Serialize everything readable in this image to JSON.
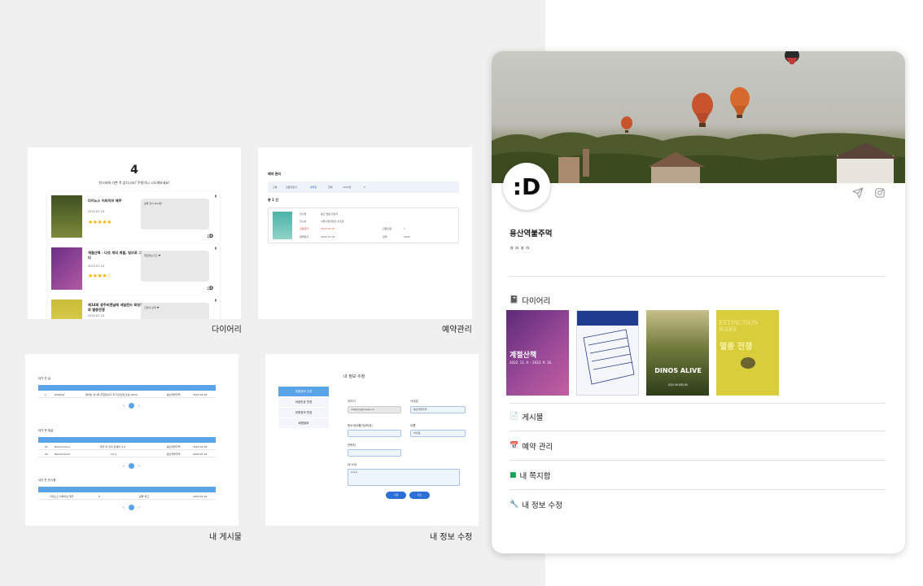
{
  "captions": {
    "diary": "다이어리",
    "reservation": "예약관리",
    "board": "내 게시물",
    "edit": "내 정보 수정"
  },
  "diary_panel": {
    "count": "4",
    "subtitle": "한시되에 기쁜 적 없디고요? 주말이니 시도해보세요!",
    "entries": [
      {
        "title": "다이노스 어라이브 제주",
        "date": "2023-07-24",
        "stars": "★★★★★",
        "memo": "공룡 정시 Nez닭!",
        "logo": ":D"
      },
      {
        "title": "계절산책 - 다섯 개의 계절, 빛으로 그리다",
        "date": "2023-07-24",
        "stars": "★★★★☆",
        "memo": "재밌었는다고 ♥",
        "logo": ":D"
      },
      {
        "title": "제14회 광주비엔날레 세일런드 회빙으로 멸종전쟁",
        "date": "2023-07-24",
        "stars": "",
        "memo": "긴장이 브레 ♥",
        "logo": ""
      }
    ]
  },
  "reservation_panel": {
    "title": "예약 관리",
    "filter_label": "구분",
    "filter_options": [
      "관람전일자",
      "예약일",
      "전체"
    ],
    "filter_value": "2023년",
    "count": "총 1 건",
    "rows": [
      [
        "전시명",
        "용산 법원 앙상리"
      ],
      [
        "전시처",
        "서울시립미술관 서소문"
      ],
      [
        "관람일자",
        "2023-07-27"
      ],
      [
        "결제일자",
        "2023-07-24"
      ]
    ],
    "side_rows": [
      [
        "관람인원",
        "1"
      ],
      [
        "금액",
        "4000"
      ]
    ]
  },
  "board_panel": {
    "sections": [
      {
        "label": "내가 쓴 글",
        "rows": [
          [
            "1",
            "6005ide",
            "에너빈 전시회 추천합니다 후 다인인제 관보 (Post)",
            "용산역불주먹",
            "2023-07-24"
          ]
        ]
      },
      {
        "label": "내가 쓴 댓글",
        "rows": [
          [
            "41",
            "Recommend",
            "법주 미 장미 관새이 ㅎㅎ",
            "용산역불주먹",
            "2023-07-24"
          ],
          [
            "42",
            "Recommend",
            "ㅋㅋㅋ",
            "용산역불주먹",
            "2023-07-24"
          ]
        ]
      },
      {
        "label": "내가 쓴 전시평",
        "rows": [
          [
            "다이노스 어라이브 제주",
            "5",
            "공룡 최고",
            "2023-07-24"
          ]
        ]
      }
    ]
  },
  "edit_panel": {
    "title": "내 정보 수정",
    "menu": [
      "회원정보 수정",
      "비밀번호 변경",
      "취향정보 변경",
      "회원탈퇴"
    ],
    "fields": [
      {
        "label": "아이디",
        "value": "o0ailyrig@naver.co"
      },
      {
        "label": "닉네임",
        "value": "용산역불주먹"
      },
      {
        "label": "한소개(3줄이상작성)",
        "value": ""
      },
      {
        "label": "이름",
        "value": "이사람"
      },
      {
        "label": "연락처",
        "value": ""
      },
      {
        "label": "내 소개",
        "value": "ㅎㅎㅎ"
      }
    ],
    "buttons": [
      "수정",
      "취소"
    ]
  },
  "profile": {
    "avatar_text": ":D",
    "username": "용산역불주먹",
    "bio": "ㅎㅇㅎㅇ",
    "menu": {
      "diary": "다이어리",
      "posts": "게시물",
      "reservations": "예약 관리",
      "messages": "내 쪽지함",
      "edit_info": "내 정보 수정"
    },
    "icons": [
      "send-icon",
      "instagram-icon"
    ],
    "posters": [
      {
        "title": "계절산책",
        "sub": "2022. 11. 9. - 2023. 9. 16.",
        "color": "#7b3a8c"
      },
      {
        "title": "",
        "sub": "",
        "color": "#f2f5fb"
      },
      {
        "title": "DINOS ALIVE",
        "sub": "JEJU MUSEUM",
        "color": "#4a5a2a"
      },
      {
        "title": "멸종 전쟁",
        "sub": "EXTINCTION WARS",
        "color": "#d8cc3a"
      }
    ]
  }
}
